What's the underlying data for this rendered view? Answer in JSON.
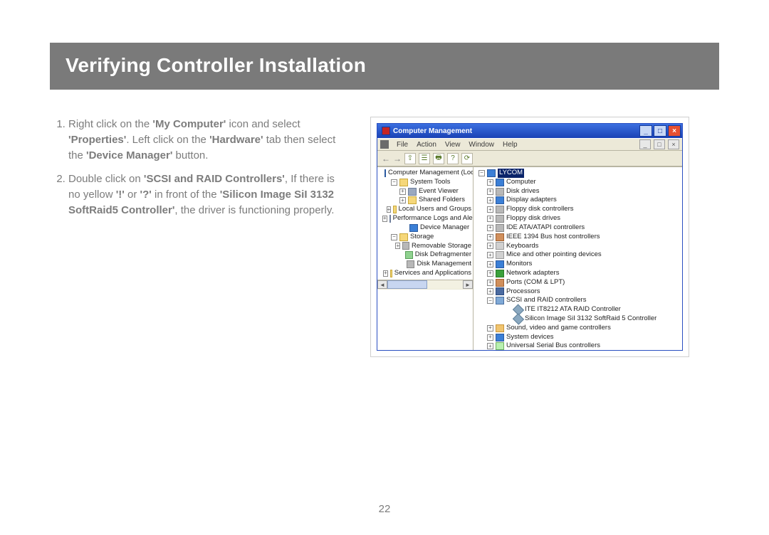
{
  "heading": "Verifying Controller Installation",
  "steps": [
    {
      "parts": [
        {
          "t": "Right click on the "
        },
        {
          "t": "'My Computer'",
          "b": true
        },
        {
          "t": " icon and select "
        },
        {
          "t": "'Properties'",
          "b": true
        },
        {
          "t": ".  Left click on the "
        },
        {
          "t": "'Hardware'",
          "b": true
        },
        {
          "t": " tab then select the "
        },
        {
          "t": "'Device Manager'",
          "b": true
        },
        {
          "t": " button."
        }
      ]
    },
    {
      "parts": [
        {
          "t": "Double click on "
        },
        {
          "t": "'SCSI and RAID Controllers'",
          "b": true
        },
        {
          "t": ", If there is no yellow "
        },
        {
          "t": "'!'",
          "b": true
        },
        {
          "t": " or "
        },
        {
          "t": "'?'",
          "b": true
        },
        {
          "t": " in front of the "
        },
        {
          "t": "'Silicon Image SiI 3132 SoftRaid5 Controller'",
          "b": true
        },
        {
          "t": ", the driver is functioning properly."
        }
      ]
    }
  ],
  "pageNumber": "22",
  "win": {
    "title": "Computer Management",
    "menus": [
      "File",
      "Action",
      "View",
      "Window",
      "Help"
    ],
    "leftTree": {
      "root": "Computer Management (Local)",
      "groups": [
        {
          "label": "System Tools",
          "items": [
            "Event Viewer",
            "Shared Folders",
            "Local Users and Groups",
            "Performance Logs and Alerts",
            "Device Manager"
          ]
        },
        {
          "label": "Storage",
          "items": [
            "Removable Storage",
            "Disk Defragmenter",
            "Disk Management"
          ]
        },
        {
          "label": "Services and Applications",
          "items": []
        }
      ]
    },
    "rightTree": {
      "root": "LYCOM",
      "items": [
        {
          "label": "Computer",
          "ic": "mon"
        },
        {
          "label": "Disk drives",
          "ic": "drv"
        },
        {
          "label": "Display adapters",
          "ic": "mon"
        },
        {
          "label": "Floppy disk controllers",
          "ic": "drv"
        },
        {
          "label": "Floppy disk drives",
          "ic": "drv"
        },
        {
          "label": "IDE ATA/ATAPI controllers",
          "ic": "drv"
        },
        {
          "label": "IEEE 1394 Bus host controllers",
          "ic": "pci"
        },
        {
          "label": "Keyboards",
          "ic": "kbd"
        },
        {
          "label": "Mice and other pointing devices",
          "ic": "kbd"
        },
        {
          "label": "Monitors",
          "ic": "mon"
        },
        {
          "label": "Network adapters",
          "ic": "net"
        },
        {
          "label": "Ports (COM & LPT)",
          "ic": "pci"
        },
        {
          "label": "Processors",
          "ic": "cpu"
        },
        {
          "label": "SCSI and RAID controllers",
          "ic": "scsi",
          "expanded": true,
          "children": [
            {
              "label": "ITE IT8212 ATA RAID Controller",
              "ic": "diam"
            },
            {
              "label": "Silicon Image SiI 3132 SoftRaid 5 Controller",
              "ic": "diam"
            }
          ]
        },
        {
          "label": "Sound, video and game controllers",
          "ic": "snd"
        },
        {
          "label": "System devices",
          "ic": "mon"
        },
        {
          "label": "Universal Serial Bus controllers",
          "ic": "usb"
        }
      ]
    }
  }
}
